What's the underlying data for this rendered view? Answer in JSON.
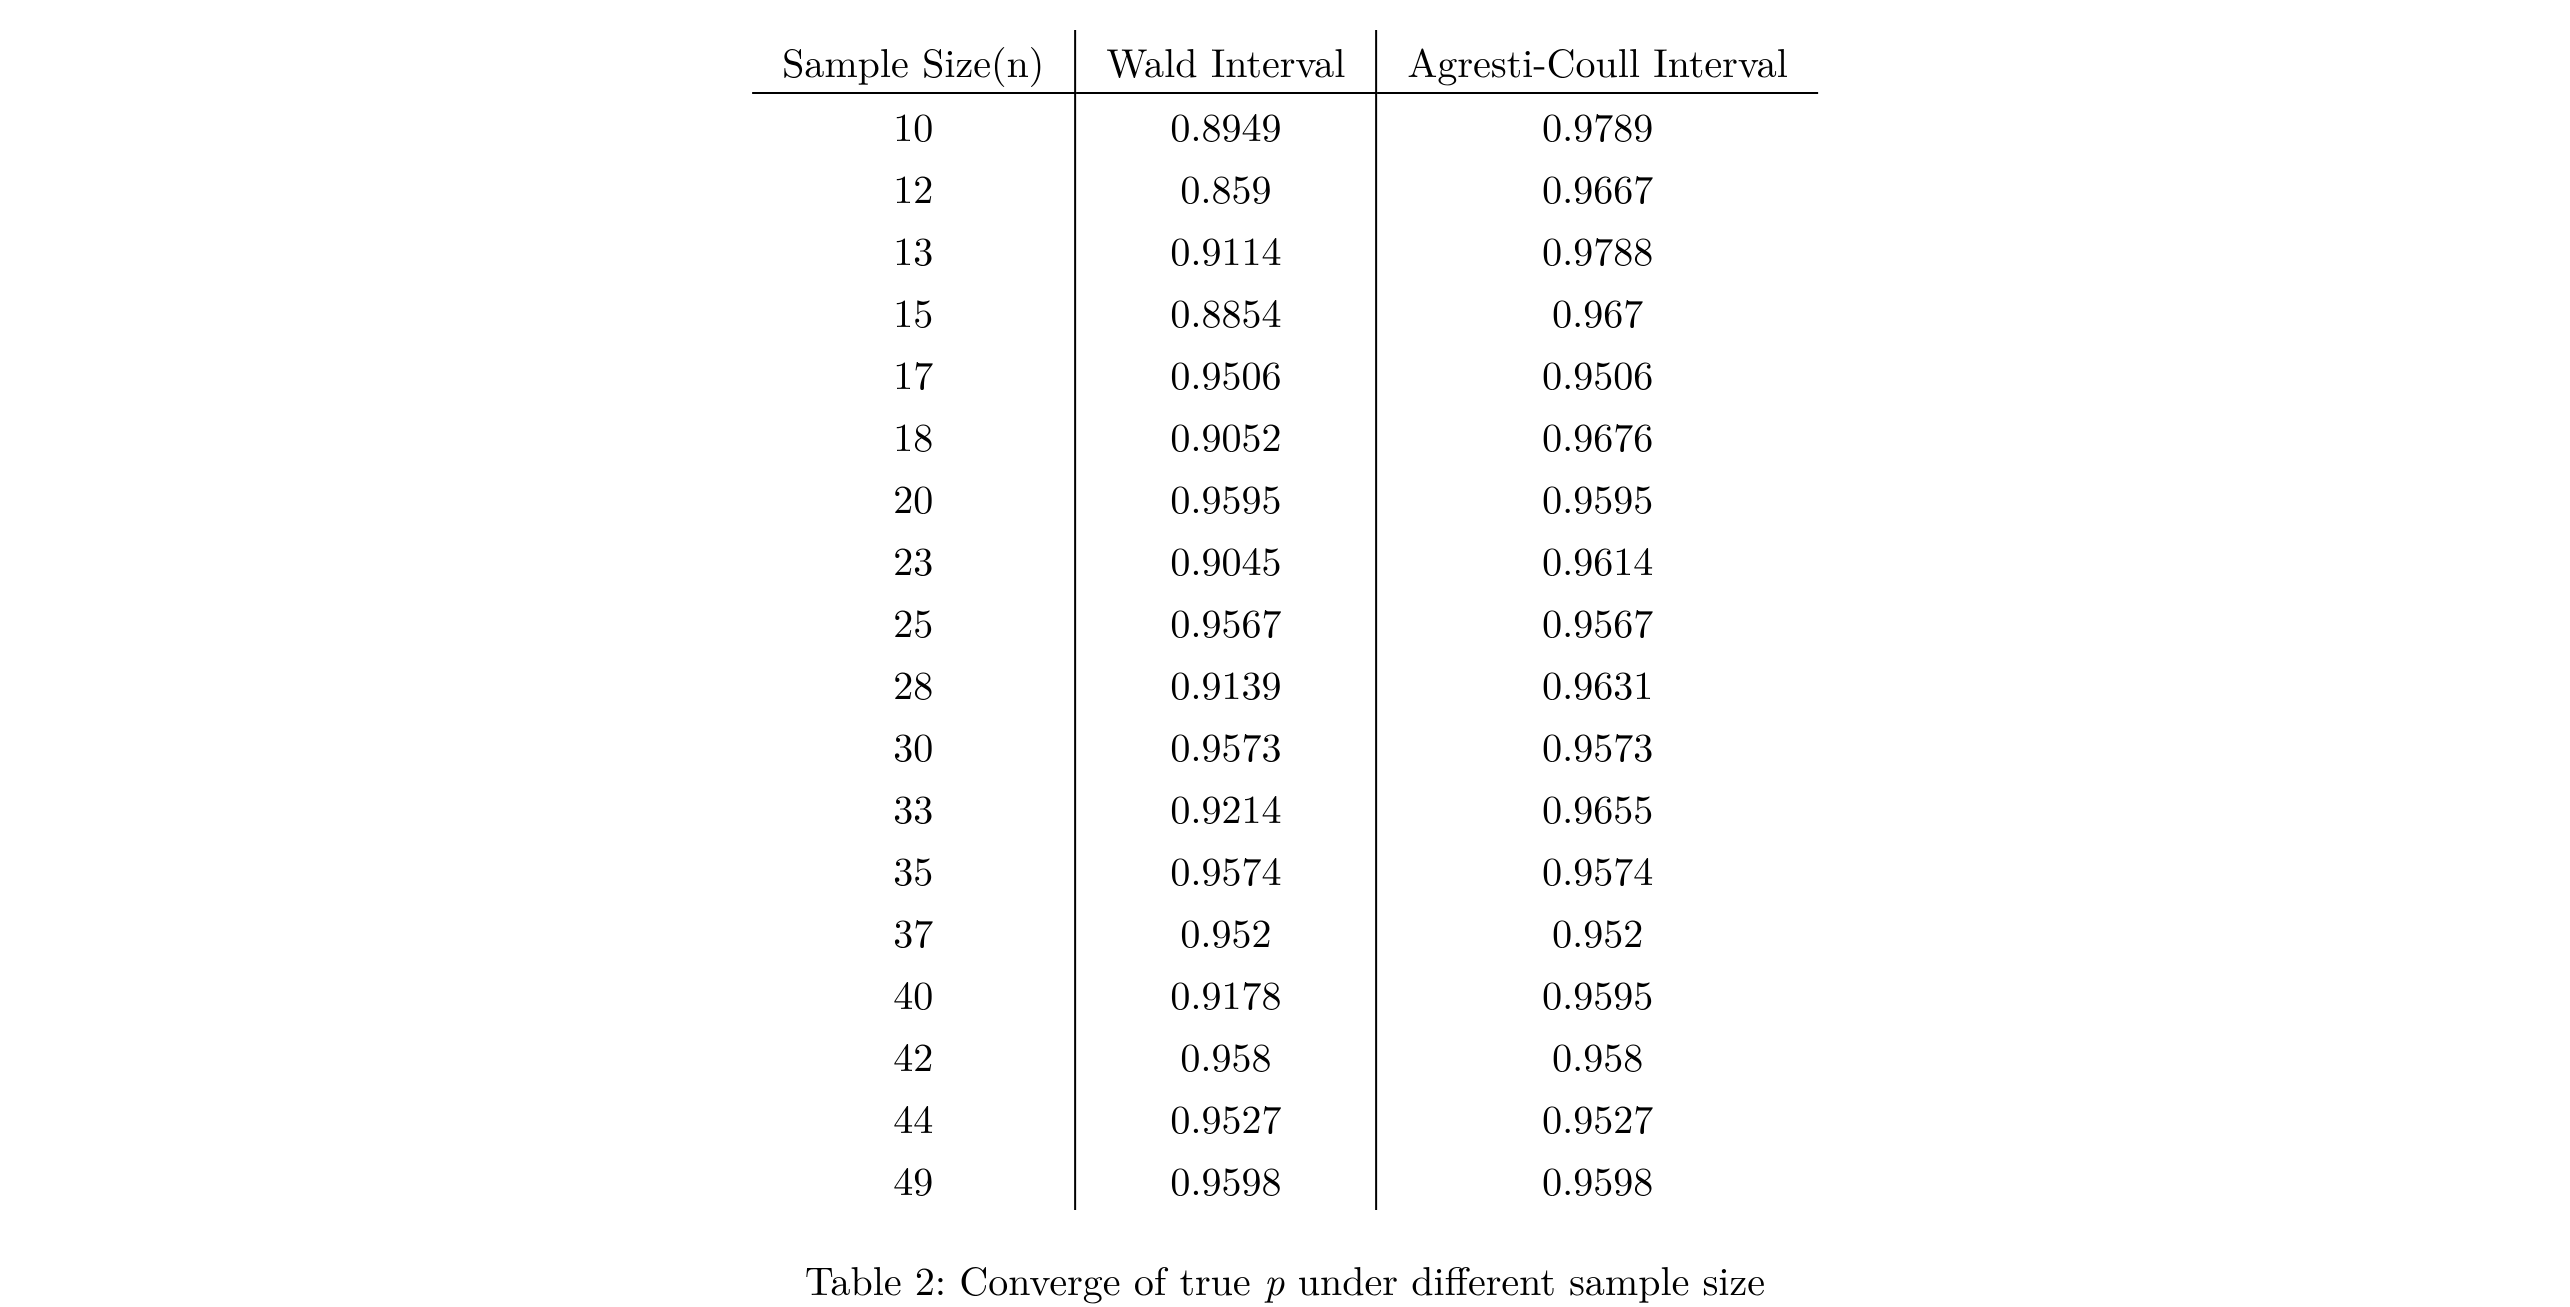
{
  "table": {
    "headers": [
      "Sample Size(n)",
      "Wald Interval",
      "Agresti-Coull Interval"
    ],
    "rows": [
      {
        "n": "10",
        "wald": "0.8949",
        "ac": "0.9789"
      },
      {
        "n": "12",
        "wald": "0.859",
        "ac": "0.9667"
      },
      {
        "n": "13",
        "wald": "0.9114",
        "ac": "0.9788"
      },
      {
        "n": "15",
        "wald": "0.8854",
        "ac": "0.967"
      },
      {
        "n": "17",
        "wald": "0.9506",
        "ac": "0.9506"
      },
      {
        "n": "18",
        "wald": "0.9052",
        "ac": "0.9676"
      },
      {
        "n": "20",
        "wald": "0.9595",
        "ac": "0.9595"
      },
      {
        "n": "23",
        "wald": "0.9045",
        "ac": "0.9614"
      },
      {
        "n": "25",
        "wald": "0.9567",
        "ac": "0.9567"
      },
      {
        "n": "28",
        "wald": "0.9139",
        "ac": "0.9631"
      },
      {
        "n": "30",
        "wald": "0.9573",
        "ac": "0.9573"
      },
      {
        "n": "33",
        "wald": "0.9214",
        "ac": "0.9655"
      },
      {
        "n": "35",
        "wald": "0.9574",
        "ac": "0.9574"
      },
      {
        "n": "37",
        "wald": "0.952",
        "ac": "0.952"
      },
      {
        "n": "40",
        "wald": "0.9178",
        "ac": "0.9595"
      },
      {
        "n": "42",
        "wald": "0.958",
        "ac": "0.958"
      },
      {
        "n": "44",
        "wald": "0.9527",
        "ac": "0.9527"
      },
      {
        "n": "49",
        "wald": "0.9598",
        "ac": "0.9598"
      }
    ]
  },
  "caption": {
    "prefix": "Table 2: Converge of true ",
    "var": "p",
    "suffix": " under different sample size"
  },
  "chart_data": {
    "type": "table",
    "title": "Converge of true p under different sample size",
    "columns": [
      "Sample Size(n)",
      "Wald Interval",
      "Agresti-Coull Interval"
    ],
    "data": [
      [
        10,
        0.8949,
        0.9789
      ],
      [
        12,
        0.859,
        0.9667
      ],
      [
        13,
        0.9114,
        0.9788
      ],
      [
        15,
        0.8854,
        0.967
      ],
      [
        17,
        0.9506,
        0.9506
      ],
      [
        18,
        0.9052,
        0.9676
      ],
      [
        20,
        0.9595,
        0.9595
      ],
      [
        23,
        0.9045,
        0.9614
      ],
      [
        25,
        0.9567,
        0.9567
      ],
      [
        28,
        0.9139,
        0.9631
      ],
      [
        30,
        0.9573,
        0.9573
      ],
      [
        33,
        0.9214,
        0.9655
      ],
      [
        35,
        0.9574,
        0.9574
      ],
      [
        37,
        0.952,
        0.952
      ],
      [
        40,
        0.9178,
        0.9595
      ],
      [
        42,
        0.958,
        0.958
      ],
      [
        44,
        0.9527,
        0.9527
      ],
      [
        49,
        0.9598,
        0.9598
      ]
    ]
  }
}
